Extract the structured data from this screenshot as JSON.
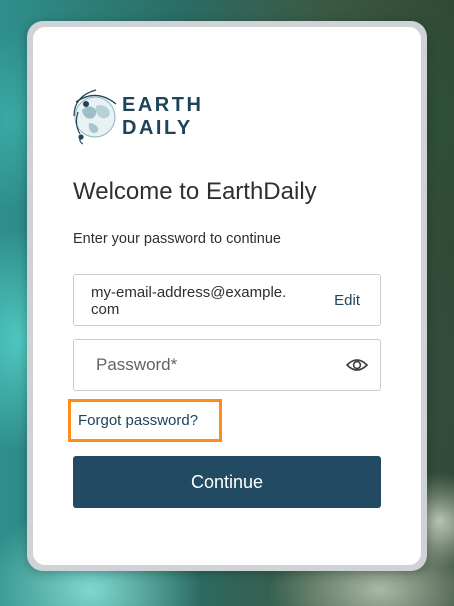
{
  "brand": {
    "logo_line1": "EARTH",
    "logo_line2": "DAILY",
    "icon": "earth-globe-icon",
    "color": "#1e4459"
  },
  "login": {
    "title": "Welcome to EarthDaily",
    "subtitle": "Enter your password to continue",
    "email_value": "my-email-address@example.com",
    "edit_label": "Edit",
    "password_placeholder": "Password*",
    "password_toggle_icon": "eye-icon",
    "forgot_label": "Forgot password?",
    "continue_label": "Continue"
  },
  "colors": {
    "primary_button": "#234a63",
    "highlight": "#ff8c1a",
    "link": "#1e4459"
  }
}
